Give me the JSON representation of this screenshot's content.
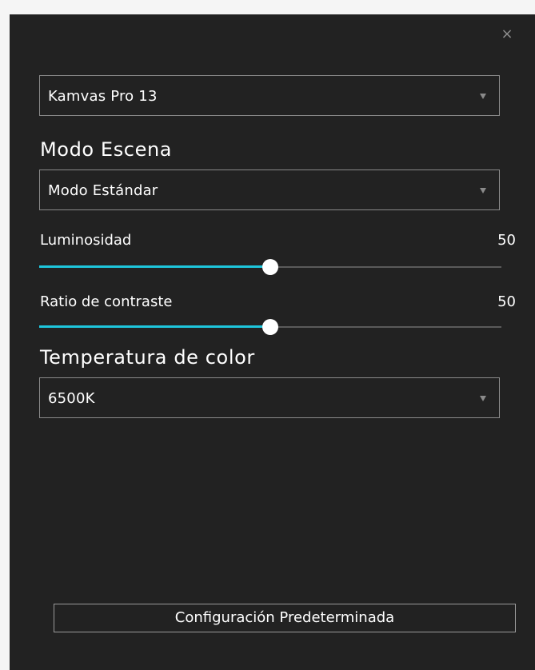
{
  "window": {
    "close_symbol": "×",
    "close_icon": "close-icon"
  },
  "device_select": {
    "value": "Kamvas Pro 13"
  },
  "scene_mode": {
    "title": "Modo Escena",
    "value": "Modo Estándar"
  },
  "brightness": {
    "label": "Luminosidad",
    "value": "50",
    "fraction": 0.5
  },
  "contrast": {
    "label": "Ratio de contraste",
    "value": "50",
    "fraction": 0.5
  },
  "color_temperature": {
    "title": "Temperatura de color",
    "value": "6500K"
  },
  "reset_button": {
    "label": "Configuración Predeterminada"
  },
  "colors": {
    "background": "#222222",
    "accent": "#1ec6dc",
    "border": "#8a8a8a"
  }
}
